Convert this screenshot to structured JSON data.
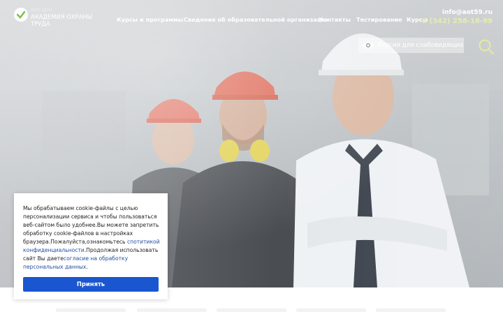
{
  "header": {
    "logo": {
      "small_text": "АНО ДПО",
      "title": "АКАДЕМИЯ ОХРАНЫ ТРУДА"
    },
    "nav": [
      {
        "label": "Курсы и программы"
      },
      {
        "label": "Сведения об образовательной организации"
      },
      {
        "label": "Контакты"
      },
      {
        "label": "Тестирование"
      },
      {
        "label": "Курсы"
      }
    ],
    "email": "info@aot59.ru",
    "phone": "8 (342) 258-16-99",
    "vision_button": "Версия для слабовидящих",
    "icons": {
      "vision": "eye-icon",
      "search": "search-icon",
      "logo": "check-icon"
    },
    "colors": {
      "phone": "#e2edb3",
      "accent_search": "#e4ef9a"
    }
  },
  "hero": {
    "image": "three-workers-in-hard-hats-photo"
  },
  "cookie": {
    "text_1": "Мы обрабатываем cookie-файлы с целью персонализации сервиса и чтобы пользоваться веб-сайтом было удобнее.Вы можете запретить обработку cookie-файлов в настройках браузера.Пожалуйста,ознакомьтесь ",
    "link_1": "спотитикой конфиденциальности",
    "text_2": ".Продолжая использовать сайт Вы даете",
    "link_2": "согласие на обработку персональных данных",
    "text_3": ".",
    "accept_label": "Принять",
    "colors": {
      "button": "#1a56cf",
      "link": "#1f4ea3"
    }
  }
}
